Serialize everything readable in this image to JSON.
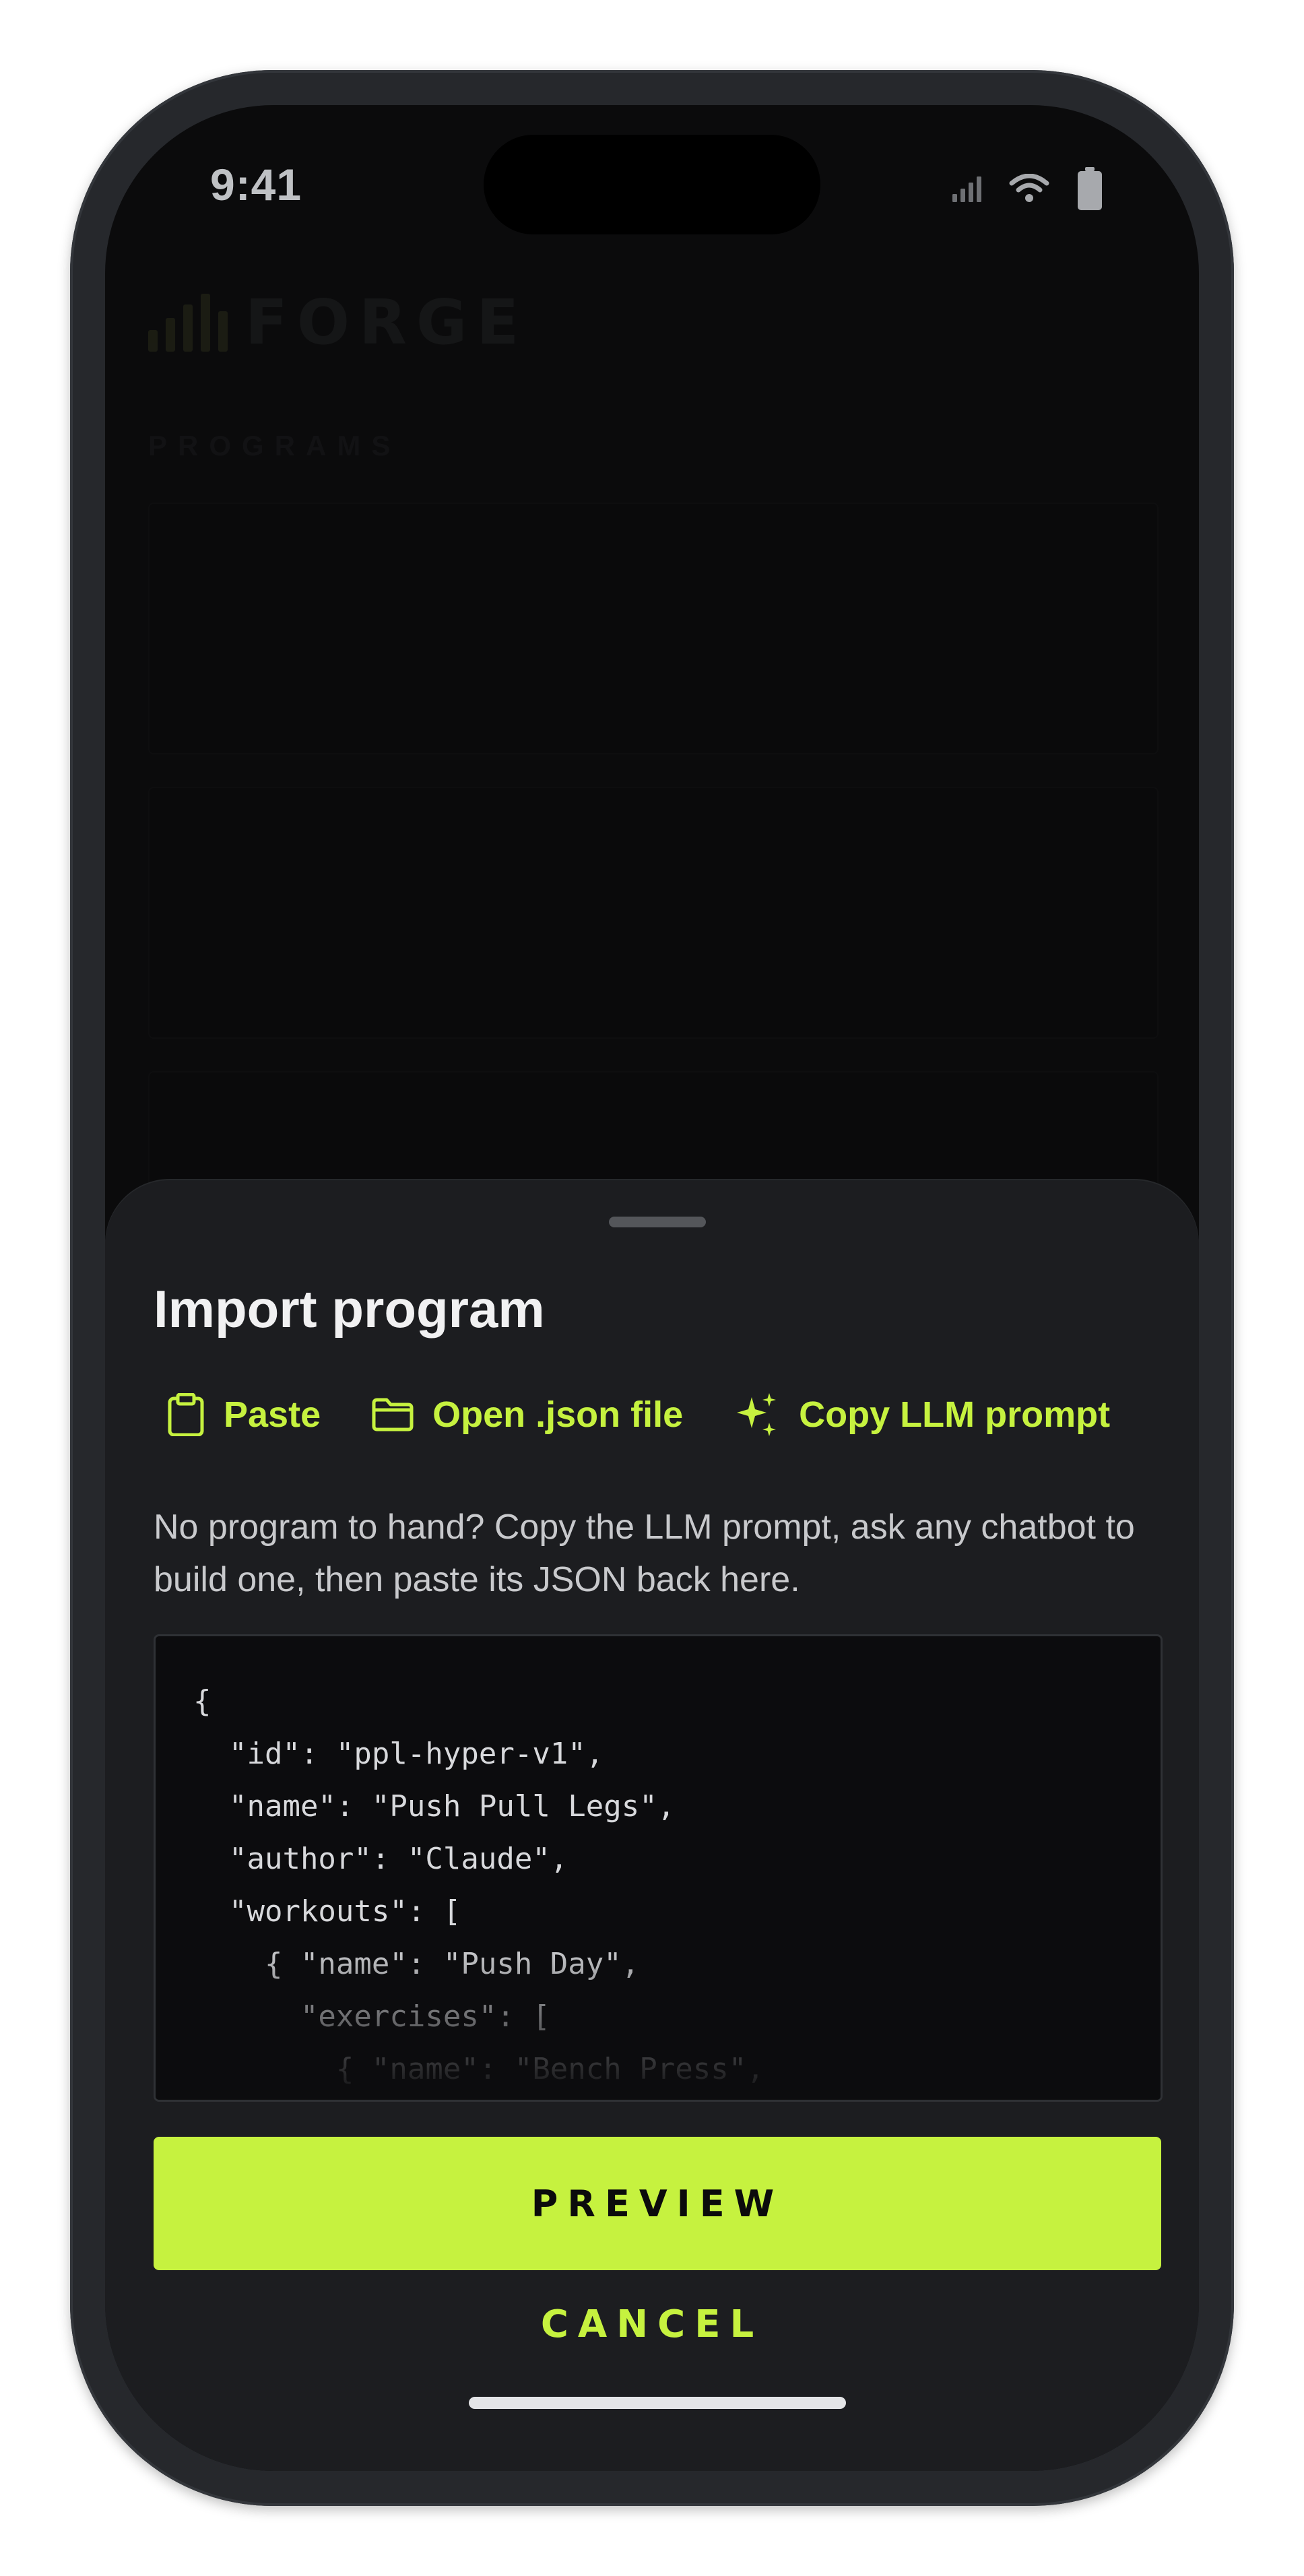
{
  "status_bar": {
    "time": "9:41",
    "icons": [
      "cellular-signal-icon",
      "wifi-icon",
      "battery-icon"
    ]
  },
  "background": {
    "app_name": "FORGE",
    "section_label": "PROGRAMS",
    "logo_icon": "bar-chart-icon"
  },
  "sheet": {
    "title": "Import program",
    "actions": [
      {
        "label": "Paste",
        "icon": "clipboard-icon"
      },
      {
        "label": "Open .json file",
        "icon": "folder-icon"
      },
      {
        "label": "Copy LLM prompt",
        "icon": "sparkles-icon"
      }
    ],
    "helper_text": "No program to hand? Copy the LLM prompt, ask any chatbot to build one, then paste its JSON back here.",
    "json_value": "{\n  \"id\": \"ppl-hyper-v1\",\n  \"name\": \"Push Pull Legs\",\n  \"author\": \"Claude\",\n  \"workouts\": [\n    { \"name\": \"Push Day\",\n      \"exercises\": [\n        { \"name\": \"Bench Press\",",
    "preview_label": "PREVIEW",
    "cancel_label": "CANCEL"
  },
  "colors": {
    "accent": "#c6f23f",
    "sheet_bg": "#1c1d20",
    "screen_bg": "#0b0b0c"
  }
}
